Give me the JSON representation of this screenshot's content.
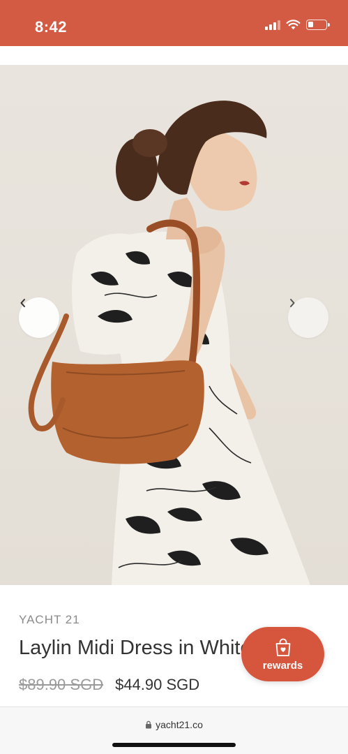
{
  "status_bar": {
    "time": "8:42",
    "background": "#d35a43",
    "icons": [
      "signal-icon",
      "wifi-icon",
      "battery-icon"
    ],
    "battery_level": 0.3
  },
  "product": {
    "brand": "YACHT 21",
    "title": "Laylin Midi Dress in White",
    "original_price": "$89.90 SGD",
    "sale_price": "$44.90 SGD",
    "image": "model-wearing-white-floral-midi-dress-with-tan-shoulder-bag"
  },
  "carousel": {
    "prev_icon": "chevron-left-icon",
    "next_icon": "chevron-right-icon"
  },
  "rewards": {
    "label": "rewards",
    "icon": "shopping-bag-heart-icon",
    "color": "#d6553d"
  },
  "browser": {
    "url": "yacht21.co",
    "lock_icon": "lock-icon"
  }
}
